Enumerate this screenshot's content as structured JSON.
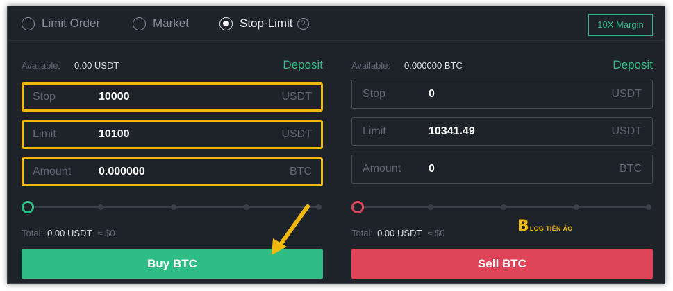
{
  "tabs": [
    {
      "label": "Limit Order",
      "selected": false
    },
    {
      "label": "Market",
      "selected": false
    },
    {
      "label": "Stop-Limit",
      "selected": true
    }
  ],
  "help_icon": "question-circle-icon",
  "margin_button": "10X Margin",
  "buy_panel": {
    "available_label": "Available:",
    "available_value": "0.00 USDT",
    "deposit_label": "Deposit",
    "fields": [
      {
        "label": "Stop",
        "value": "10000",
        "unit": "USDT"
      },
      {
        "label": "Limit",
        "value": "10100",
        "unit": "USDT"
      },
      {
        "label": "Amount",
        "value": "0.000000",
        "unit": "BTC"
      }
    ],
    "slider_percent": 0,
    "total_label": "Total:",
    "total_value": "0.00 USDT",
    "total_approx": "≈ $0",
    "action_label": "Buy BTC"
  },
  "sell_panel": {
    "available_label": "Available:",
    "available_value": "0.000000 BTC",
    "deposit_label": "Deposit",
    "fields": [
      {
        "label": "Stop",
        "value": "0",
        "unit": "USDT"
      },
      {
        "label": "Limit",
        "value": "10341.49",
        "unit": "USDT"
      },
      {
        "label": "Amount",
        "value": "0",
        "unit": "BTC"
      }
    ],
    "slider_percent": 0,
    "total_label": "Total:",
    "total_value": "0.00 USDT",
    "total_approx": "≈ $0",
    "action_label": "Sell BTC"
  },
  "watermark": {
    "mark": "B",
    "text": "LOG TIỀN ẢO"
  },
  "colors": {
    "buy": "#2ebd85",
    "sell": "#e04459",
    "highlight": "#f0b90b",
    "background": "#1e2329"
  }
}
